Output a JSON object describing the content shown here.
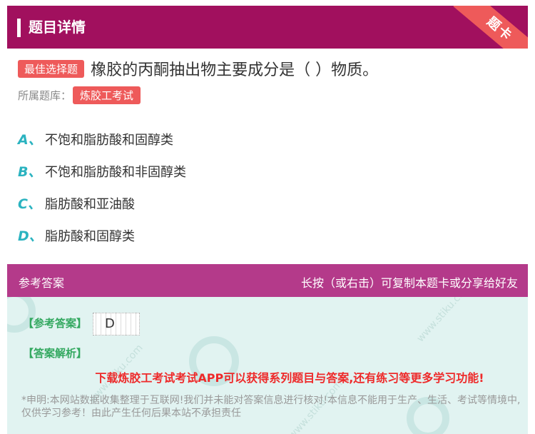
{
  "header": {
    "title": "题目详情",
    "ribbon_label": "题卡"
  },
  "question": {
    "type_badge": "最佳选择题",
    "text": "橡胶的丙酮抽出物主要成分是（ ）物质。",
    "bank_label": "所属题库：",
    "bank_name": "炼胶工考试"
  },
  "options": [
    {
      "letter": "A",
      "sep": "、",
      "text": "不饱和脂肪酸和固醇类"
    },
    {
      "letter": "B",
      "sep": "、",
      "text": "不饱和脂肪酸和非固醇类"
    },
    {
      "letter": "C",
      "sep": "、",
      "text": "脂肪酸和亚油酸"
    },
    {
      "letter": "D",
      "sep": "、",
      "text": "脂肪酸和固醇类"
    }
  ],
  "answer_section": {
    "title": "参考答案",
    "hint": "长按（或右击）可复制本题卡或分享给好友",
    "ref_label": "【参考答案】",
    "ref_value": "D",
    "analysis_label": "【答案解析】",
    "promo": "下载炼胶工考试考试APP可以获得系列题目与答案,还有练习等更多学习功能!",
    "disclaimer": "*申明:本网站数据收集整理于互联网!我们并未能对答案信息进行核对!本信息不能用于生产、生活、考试等情境中,仅供学习参考！由此产生任何后果本站不承担责任"
  },
  "colors": {
    "header_bg": "#a1105e",
    "badge_red": "#ee5a5a",
    "option_letter": "#2bb3c0",
    "answer_header_bg": "#b43a8a",
    "answer_body_bg": "#e1f3f1",
    "label_green": "#33a860",
    "promo_red": "#ee2a2a"
  }
}
